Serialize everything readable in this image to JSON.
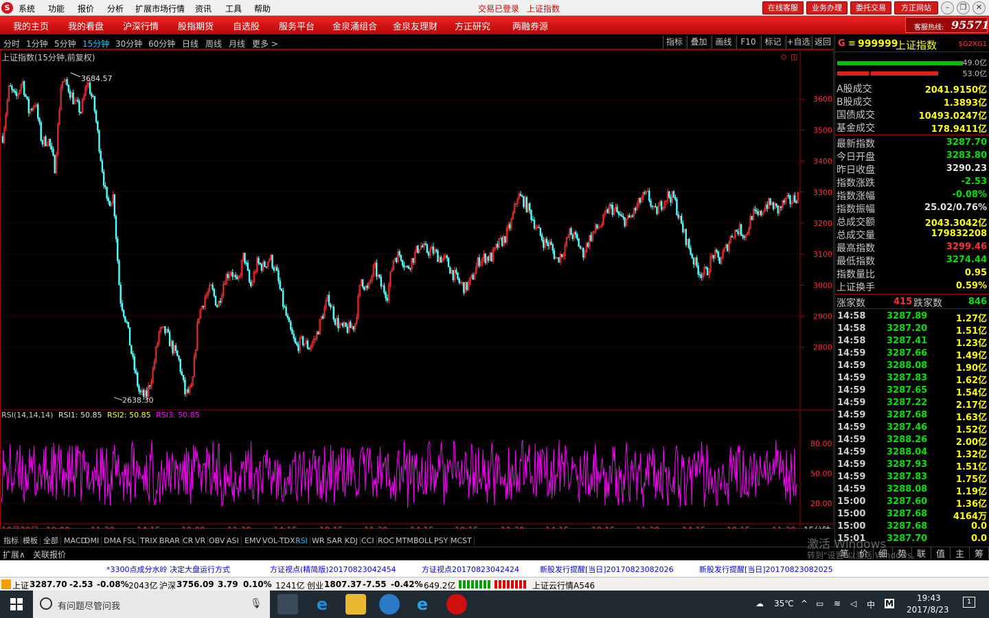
{
  "menubar": {
    "logo": "S",
    "items": [
      "系统",
      "功能",
      "报价",
      "分析",
      "扩展市场行情",
      "资讯",
      "工具",
      "帮助"
    ],
    "status": "交易已登录",
    "index_name": "上证指数",
    "buttons": [
      "在线客服",
      "业务办理",
      "委托交易",
      "方正网站"
    ]
  },
  "navbar": {
    "items": [
      "我的主页",
      "我的看盘",
      "沪深行情",
      "股指期货",
      "自选股",
      "服务平台",
      "金泉涌组合",
      "金泉友理财",
      "方正研究",
      "两融券源"
    ],
    "hotline_label": "客服热线:",
    "hotline_number": "95571"
  },
  "periodbar": {
    "periods": [
      "分时",
      "1分钟",
      "5分钟",
      "15分钟",
      "30分钟",
      "60分钟",
      "日线",
      "周线",
      "月线",
      "更多 >"
    ],
    "tools": [
      "指标",
      "叠加",
      "画线",
      "F10",
      "标记",
      "+自选",
      "返回"
    ]
  },
  "chart": {
    "title": "上证指数(15分钟,前复权)",
    "high_label": "3684.57",
    "low_label": "2638.30",
    "rsi_title": "RSI(14,14,14)",
    "rsi1": "RSI1: 50.85",
    "rsi2": "RSI2: 50.85",
    "rsi3": "RSI3: 50.85",
    "price_axis": [
      "3600",
      "3500",
      "3400",
      "3300",
      "3200",
      "3100",
      "3000",
      "2900",
      "2800"
    ],
    "rsi_axis": [
      "80.00",
      "50.00",
      "20.00"
    ],
    "time_axis": [
      "10月29日",
      "10:00",
      "11:30",
      "14:15",
      "10:00",
      "11:30",
      "14:15",
      "10:15",
      "11:30",
      "14:15",
      "10:15",
      "11:30",
      "14:15",
      "10:15",
      "11:30",
      "14:15",
      "10:15",
      "11:30"
    ],
    "period_label": "15分钟",
    "colors": {
      "up": "#ff3030",
      "down": "#54ffff",
      "rsi": "#ff00ff",
      "grid": "#8b0000"
    }
  },
  "chart_data": {
    "type": "line",
    "title": "上证指数(15分钟,前复权)",
    "y_axis_ticks": [
      3600,
      3500,
      3400,
      3300,
      3200,
      3100,
      3000,
      2900,
      2800
    ],
    "ylim": [
      2600,
      3720
    ],
    "series": [
      {
        "name": "上证指数",
        "values": [
          3480,
          3640,
          3600,
          3660,
          3560,
          3590,
          3460,
          3470,
          3380,
          3660,
          3640,
          3590,
          3560,
          3660,
          3580,
          3420,
          3260,
          3290,
          2960,
          2880,
          2750,
          2650,
          2640,
          2720,
          2850,
          2850,
          2800,
          2760,
          2650,
          2660,
          2900,
          2960,
          2990,
          2930,
          3020,
          3050,
          3000,
          3100,
          2990,
          3070,
          3060,
          3090,
          3040,
          2940,
          2860,
          2800,
          2820,
          2800,
          2830,
          2900,
          2960,
          2890,
          2860,
          2860,
          2870,
          3020,
          2980,
          3060,
          3000,
          2970,
          3090,
          3100,
          3050,
          3090,
          3130,
          3110,
          3110,
          3090,
          3080,
          3040,
          3010,
          2990,
          3020,
          3080,
          3090,
          3090,
          3130,
          3150,
          3200,
          3290,
          3270,
          3230,
          3180,
          3140,
          3130,
          3080,
          3110,
          3170,
          3150,
          3100,
          3150,
          3180,
          3200,
          3250,
          3240,
          3210,
          3210,
          3240,
          3280,
          3290,
          3230,
          3260,
          3290,
          3280,
          3200,
          3140,
          3080,
          3040,
          3040,
          3100,
          3080,
          3120,
          3170,
          3180,
          3160,
          3230,
          3220,
          3260,
          3260,
          3240,
          3270,
          3270,
          3290
        ]
      },
      {
        "name": "RSI1",
        "values": [
          50,
          48,
          52,
          55,
          45,
          50,
          60,
          40,
          55,
          50,
          45,
          58,
          50,
          42,
          55,
          50,
          48,
          60,
          45,
          52,
          50,
          47,
          53,
          50,
          55,
          45,
          52,
          50,
          48,
          55,
          50,
          52,
          46,
          54,
          50,
          48,
          56,
          50,
          44,
          55,
          50,
          52,
          48,
          50,
          54,
          46,
          52,
          50,
          55,
          48,
          50,
          52,
          47,
          55,
          50,
          48,
          53,
          50,
          52,
          50,
          46,
          54,
          50,
          50,
          48,
          55,
          52,
          50,
          47,
          53,
          50,
          50,
          51,
          49,
          52,
          50,
          48,
          54,
          50,
          50,
          51
        ]
      }
    ],
    "rsi_ticks": [
      80,
      50,
      20
    ]
  },
  "indicator_tabs": [
    "指标",
    "模板",
    "全部",
    "MACD",
    "DMI",
    "DMA",
    "FSL",
    "TRIX",
    "BRAR",
    "CR",
    "VR",
    "OBV",
    "ASI",
    "EMV",
    "VOL-TDX",
    "RSI",
    "WR",
    "SAR",
    "KDJ",
    "CCI",
    "ROC",
    "MTM",
    "BOLL",
    "PSY",
    "MCST"
  ],
  "extbar": [
    "扩展∧",
    "关联报价"
  ],
  "right_panel": {
    "header_code": "999999",
    "header_name": "上证指数",
    "header_tag": "$G2XG1",
    "header_g": "G",
    "bar_up": "49.0亿",
    "bar_down": "53.0亿",
    "volume_rows": [
      {
        "k": "A股成交",
        "v": "2041.9150亿"
      },
      {
        "k": "B股成交",
        "v": "1.3893亿"
      },
      {
        "k": "国债成交",
        "v": "10493.0247亿"
      },
      {
        "k": "基金成交",
        "v": "178.9411亿"
      }
    ],
    "quote_rows": [
      {
        "k": "最新指数",
        "v": "3287.70",
        "c": "#00e000"
      },
      {
        "k": "今日开盘",
        "v": "3283.80",
        "c": "#00e000"
      },
      {
        "k": "昨日收盘",
        "v": "3290.23",
        "c": "#e0e0e0"
      },
      {
        "k": "指数涨跌",
        "v": "-2.53",
        "c": "#00e000"
      },
      {
        "k": "指数涨幅",
        "v": "-0.08%",
        "c": "#00e000"
      },
      {
        "k": "指数振幅",
        "v": "25.02/0.76%",
        "c": "#e0e0e0"
      },
      {
        "k": "总成交额",
        "v": "2043.3042亿",
        "c": "#ffff00"
      },
      {
        "k": "总成交量",
        "v": "179832208",
        "c": "#ffff00"
      },
      {
        "k": "最高指数",
        "v": "3299.46",
        "c": "#ff3030"
      },
      {
        "k": "最低指数",
        "v": "3274.44",
        "c": "#00e000"
      },
      {
        "k": "指数量比",
        "v": "0.95",
        "c": "#ffff00"
      },
      {
        "k": "上证换手",
        "v": "0.59%",
        "c": "#ffff00"
      }
    ],
    "up_label": "涨家数",
    "up_count": "415",
    "down_label": "跌家数",
    "down_count": "846",
    "ticks": [
      {
        "t": "14:58",
        "p": "3287.89",
        "a": "1.27亿"
      },
      {
        "t": "14:58",
        "p": "3287.20",
        "a": "1.51亿"
      },
      {
        "t": "14:58",
        "p": "3287.41",
        "a": "1.23亿"
      },
      {
        "t": "14:59",
        "p": "3287.66",
        "a": "1.49亿"
      },
      {
        "t": "14:59",
        "p": "3288.08",
        "a": "1.90亿"
      },
      {
        "t": "14:59",
        "p": "3287.83",
        "a": "1.62亿"
      },
      {
        "t": "14:59",
        "p": "3287.65",
        "a": "1.54亿"
      },
      {
        "t": "14:59",
        "p": "3287.22",
        "a": "2.17亿"
      },
      {
        "t": "14:59",
        "p": "3287.68",
        "a": "1.63亿"
      },
      {
        "t": "14:59",
        "p": "3287.46",
        "a": "1.52亿"
      },
      {
        "t": "14:59",
        "p": "3288.26",
        "a": "2.00亿"
      },
      {
        "t": "14:59",
        "p": "3288.04",
        "a": "1.32亿"
      },
      {
        "t": "14:59",
        "p": "3287.93",
        "a": "1.51亿"
      },
      {
        "t": "14:59",
        "p": "3287.83",
        "a": "1.75亿"
      },
      {
        "t": "14:59",
        "p": "3288.08",
        "a": "1.19亿"
      },
      {
        "t": "15:00",
        "p": "3287.60",
        "a": "1.36亿"
      },
      {
        "t": "15:00",
        "p": "3287.68",
        "a": "4164万"
      },
      {
        "t": "15:00",
        "p": "3287.68",
        "a": "0.0"
      },
      {
        "t": "15:01",
        "p": "3287.70",
        "a": "0.0"
      }
    ],
    "bottom_tabs": [
      "笔",
      "价",
      "细",
      "势",
      "联",
      "值",
      "主",
      "筹"
    ]
  },
  "watermark": {
    "line1": "激活 Windows",
    "line2": "转到\"设置\"以激活 Windows。"
  },
  "news": [
    "*3300点成分水岭  决定大盘运行方式",
    "方证视点(精简版)20170823042454",
    "方证视点20170823042424",
    "新股发行提醒[当日]20170823082026",
    "新股发行提醒[当日]20170823082025"
  ],
  "status": {
    "sh_label": "上证",
    "sh_val": "3287.70",
    "sh_chg": "-2.53",
    "sh_pct": "-0.08%",
    "sh_amt": "2043亿",
    "hs_label": "沪深",
    "hs_val": "3756.09",
    "hs_chg": "3.79",
    "hs_pct": "0.10%",
    "hs_amt": "1241亿",
    "cy_label": "创业",
    "cy_val": "1807.37",
    "cy_chg": "-7.55",
    "cy_pct": "-0.42%",
    "cy_amt": "649.2亿",
    "cloud": "上证云行情A546"
  },
  "taskbar": {
    "search_placeholder": "有问题尽管问我",
    "temp": "35℃",
    "ime": "中",
    "time": "19:43",
    "date": "2017/8/23",
    "notif": "1"
  }
}
